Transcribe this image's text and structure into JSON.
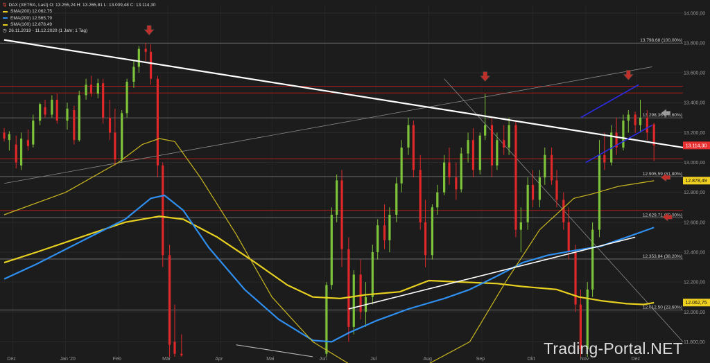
{
  "header": {
    "title": "DAX (XETRA, Last)",
    "ohlc": "O: 13.255,24 H: 13.265,81 L: 13.009,48 C: 13.114,30",
    "indicators": [
      {
        "label": "SMA(200)",
        "value": "12.062,75",
        "color": "#e8d020"
      },
      {
        "label": "EMA(200)",
        "value": "12.565,79",
        "color": "#2f8ff0"
      },
      {
        "label": "SMA(100)",
        "value": "12.878,49",
        "color": "#e8d020"
      }
    ],
    "range": "26.11.2019 - 11.12.2020",
    "interval": "(1 Jahr; 1 Tag)"
  },
  "watermark": "Trading-Portal.NET",
  "chart_data": {
    "type": "candlestick",
    "instrument": "DAX (XETRA, Last)",
    "ylim": [
      11700,
      14050
    ],
    "y_ticks": [
      {
        "v": 14000,
        "label": "14.000,00"
      },
      {
        "v": 13800,
        "label": "13.800,00"
      },
      {
        "v": 13600,
        "label": "13.600,00"
      },
      {
        "v": 13400,
        "label": "13.400,00"
      },
      {
        "v": 13200,
        "label": "13.200,00"
      },
      {
        "v": 13000,
        "label": "13.000,00"
      },
      {
        "v": 12800,
        "label": "12.800,00"
      },
      {
        "v": 12600,
        "label": "12.600,00"
      },
      {
        "v": 12400,
        "label": "12.400,00"
      },
      {
        "v": 12200,
        "label": "12.200,00"
      },
      {
        "v": 12000,
        "label": "12.000,00"
      },
      {
        "v": 11800,
        "label": "11.800,00"
      }
    ],
    "x_ticks": [
      {
        "date": "2019-12-01",
        "label": "Dez"
      },
      {
        "date": "2020-01-01",
        "label": "Jan '20"
      },
      {
        "date": "2020-02-01",
        "label": "Feb"
      },
      {
        "date": "2020-03-01",
        "label": "Mär"
      },
      {
        "date": "2020-04-01",
        "label": "Apr"
      },
      {
        "date": "2020-05-01",
        "label": "Mai"
      },
      {
        "date": "2020-06-01",
        "label": "Jun"
      },
      {
        "date": "2020-07-01",
        "label": "Jul"
      },
      {
        "date": "2020-08-01",
        "label": "Aug"
      },
      {
        "date": "2020-09-01",
        "label": "Sep"
      },
      {
        "date": "2020-10-01",
        "label": "Okt"
      },
      {
        "date": "2020-11-01",
        "label": "Nov"
      },
      {
        "date": "2020-12-01",
        "label": "Dez"
      }
    ],
    "x_range": [
      "2019-11-26",
      "2020-12-28"
    ],
    "fib_levels": [
      {
        "v": 13798.68,
        "label": "13.798,68 (100,00%)"
      },
      {
        "v": 13298.36,
        "label": "13.298,36 (78,60%)"
      },
      {
        "v": 12905.59,
        "label": "12.905,59 (61,80%)"
      },
      {
        "v": 12629.71,
        "label": "12.629,71 (50,00%)"
      },
      {
        "v": 12353.84,
        "label": "12.353,84 (38,20%)"
      },
      {
        "v": 12012.5,
        "label": "12.012,50 (23,60%)"
      }
    ],
    "red_lines": [
      13510,
      13465,
      13025,
      12680
    ],
    "price_tags": [
      {
        "v": 13114.3,
        "label": "13.114,30",
        "bg": "#e83030",
        "fg": "#ffffff"
      },
      {
        "v": 12878.49,
        "label": "12.878,49",
        "bg": "#f0d020",
        "fg": "#111111"
      },
      {
        "v": 12062.75,
        "label": "12.062,75",
        "bg": "#f0d020",
        "fg": "#111111"
      }
    ],
    "trendlines": [
      {
        "name": "resistance",
        "color": "#ffffff",
        "width": 2.2,
        "from": [
          "2019-11-26",
          13820
        ],
        "to": [
          "2020-12-28",
          13100
        ]
      },
      {
        "name": "support",
        "color": "#ffffff",
        "width": 1.6,
        "from": [
          "2020-06-15",
          12020
        ],
        "to": [
          "2020-11-30",
          12500
        ]
      },
      {
        "name": "support-early",
        "color": "#bdbdbd",
        "width": 1.1,
        "from": [
          "2020-04-10",
          11780
        ],
        "to": [
          "2020-05-25",
          11700
        ]
      },
      {
        "name": "upper-channel",
        "color": "#2c2ce8",
        "width": 1.6,
        "from": [
          "2020-10-29",
          13300
        ],
        "to": [
          "2020-12-02",
          13520
        ]
      },
      {
        "name": "lower-channel",
        "color": "#2c2ce8",
        "width": 1.6,
        "from": [
          "2020-11-01",
          13000
        ],
        "to": [
          "2020-12-10",
          13250
        ]
      },
      {
        "name": "thin-rising",
        "color": "#8a8a8a",
        "width": 0.8,
        "from": [
          "2019-11-26",
          12860
        ],
        "to": [
          "2020-12-10",
          13640
        ]
      },
      {
        "name": "thin-falling",
        "color": "#8a8a8a",
        "width": 0.8,
        "from": [
          "2020-08-10",
          13560
        ],
        "to": [
          "2020-12-28",
          11800
        ]
      }
    ],
    "markers": [
      {
        "type": "arrow-down",
        "date": "2020-02-19",
        "v": 13880,
        "color": "#c0302a"
      },
      {
        "type": "arrow-down",
        "date": "2020-09-03",
        "v": 13570,
        "color": "#c0302a"
      },
      {
        "type": "arrow-down",
        "date": "2020-11-26",
        "v": 13580,
        "color": "#c0302a"
      },
      {
        "type": "arrow-left",
        "date": "2020-12-17",
        "v": 13330,
        "color": "#9a9a9a"
      },
      {
        "type": "arrow-left",
        "date": "2020-12-17",
        "v": 12900,
        "color": "#c0302a"
      },
      {
        "type": "arrow-left",
        "date": "2020-12-18",
        "v": 12635,
        "color": "#c0302a"
      }
    ],
    "series": [
      {
        "name": "SMA(200)",
        "color": "#e8d020",
        "width": 2.2,
        "points": [
          [
            "2019-11-26",
            12330
          ],
          [
            "2019-12-15",
            12400
          ],
          [
            "2020-01-15",
            12520
          ],
          [
            "2020-02-05",
            12600
          ],
          [
            "2020-02-25",
            12640
          ],
          [
            "2020-03-10",
            12620
          ],
          [
            "2020-03-30",
            12500
          ],
          [
            "2020-04-20",
            12340
          ],
          [
            "2020-05-10",
            12180
          ],
          [
            "2020-05-25",
            12100
          ],
          [
            "2020-06-10",
            12090
          ],
          [
            "2020-06-25",
            12115
          ],
          [
            "2020-07-15",
            12135
          ],
          [
            "2020-08-01",
            12210
          ],
          [
            "2020-08-20",
            12200
          ],
          [
            "2020-09-10",
            12190
          ],
          [
            "2020-09-25",
            12170
          ],
          [
            "2020-10-15",
            12150
          ],
          [
            "2020-10-28",
            12100
          ],
          [
            "2020-11-10",
            12075
          ],
          [
            "2020-11-25",
            12055
          ],
          [
            "2020-12-05",
            12050
          ],
          [
            "2020-12-11",
            12062
          ]
        ]
      },
      {
        "name": "EMA(200)",
        "color": "#2f8ff0",
        "width": 2.2,
        "points": [
          [
            "2019-11-26",
            12220
          ],
          [
            "2019-12-15",
            12320
          ],
          [
            "2020-01-15",
            12500
          ],
          [
            "2020-02-05",
            12620
          ],
          [
            "2020-02-20",
            12760
          ],
          [
            "2020-02-28",
            12780
          ],
          [
            "2020-03-10",
            12680
          ],
          [
            "2020-03-25",
            12430
          ],
          [
            "2020-04-15",
            12150
          ],
          [
            "2020-05-05",
            11950
          ],
          [
            "2020-05-25",
            11810
          ],
          [
            "2020-06-05",
            11800
          ],
          [
            "2020-06-15",
            11860
          ],
          [
            "2020-07-01",
            11940
          ],
          [
            "2020-07-20",
            12020
          ],
          [
            "2020-08-10",
            12090
          ],
          [
            "2020-08-25",
            12150
          ],
          [
            "2020-09-10",
            12240
          ],
          [
            "2020-09-25",
            12330
          ],
          [
            "2020-10-10",
            12380
          ],
          [
            "2020-10-25",
            12410
          ],
          [
            "2020-11-10",
            12440
          ],
          [
            "2020-11-25",
            12500
          ],
          [
            "2020-12-11",
            12565
          ]
        ]
      },
      {
        "name": "SMA(100)",
        "color": "#cbb820",
        "width": 1.2,
        "points": [
          [
            "2019-11-26",
            12650
          ],
          [
            "2020-01-01",
            12800
          ],
          [
            "2020-02-01",
            13000
          ],
          [
            "2020-02-15",
            13120
          ],
          [
            "2020-02-25",
            13160
          ],
          [
            "2020-03-05",
            13140
          ],
          [
            "2020-03-20",
            12900
          ],
          [
            "2020-04-10",
            12520
          ],
          [
            "2020-05-01",
            12100
          ],
          [
            "2020-05-25",
            11800
          ],
          [
            "2020-06-15",
            11550
          ],
          [
            "2020-07-05",
            11400
          ],
          [
            "2020-08-01",
            11500
          ],
          [
            "2020-08-25",
            11800
          ],
          [
            "2020-09-15",
            12200
          ],
          [
            "2020-10-05",
            12550
          ],
          [
            "2020-10-25",
            12760
          ],
          [
            "2020-11-05",
            12790
          ],
          [
            "2020-11-20",
            12840
          ],
          [
            "2020-12-11",
            12878
          ]
        ]
      }
    ],
    "candles": [
      [
        "2019-11-26",
        13200,
        13230,
        13140,
        13160
      ],
      [
        "2019-11-29",
        13150,
        13210,
        13080,
        13190
      ],
      [
        "2019-12-03",
        13120,
        13180,
        12960,
        13000
      ],
      [
        "2019-12-06",
        12980,
        13200,
        12950,
        13160
      ],
      [
        "2019-12-10",
        13150,
        13220,
        13080,
        13110
      ],
      [
        "2019-12-13",
        13120,
        13320,
        13100,
        13280
      ],
      [
        "2019-12-17",
        13280,
        13400,
        13250,
        13390
      ],
      [
        "2019-12-20",
        13370,
        13420,
        13300,
        13320
      ],
      [
        "2019-12-24",
        13320,
        13450,
        13300,
        13420
      ],
      [
        "2019-12-27",
        13420,
        13460,
        13260,
        13280
      ],
      [
        "2020-01-02",
        13280,
        13400,
        13220,
        13360
      ],
      [
        "2020-01-06",
        13350,
        13380,
        13120,
        13150
      ],
      [
        "2020-01-09",
        13150,
        13480,
        13140,
        13450
      ],
      [
        "2020-01-13",
        13450,
        13560,
        13420,
        13520
      ],
      [
        "2020-01-16",
        13520,
        13580,
        13440,
        13460
      ],
      [
        "2020-01-20",
        13460,
        13560,
        13430,
        13530
      ],
      [
        "2020-01-23",
        13530,
        13560,
        13260,
        13300
      ],
      [
        "2020-01-27",
        13300,
        13420,
        13150,
        13200
      ],
      [
        "2020-01-30",
        13200,
        13360,
        12980,
        13020
      ],
      [
        "2020-02-03",
        13020,
        13350,
        13000,
        13330
      ],
      [
        "2020-02-06",
        13330,
        13560,
        13300,
        13540
      ],
      [
        "2020-02-10",
        13540,
        13680,
        13500,
        13640
      ],
      [
        "2020-02-13",
        13640,
        13780,
        13600,
        13760
      ],
      [
        "2020-02-17",
        13760,
        13800,
        13680,
        13740
      ],
      [
        "2020-02-20",
        13740,
        13790,
        13520,
        13560
      ],
      [
        "2020-02-24",
        13560,
        13580,
        12900,
        12980
      ],
      [
        "2020-02-27",
        12980,
        13000,
        12300,
        12380
      ],
      [
        "2020-03-02",
        12380,
        12450,
        11700,
        11780
      ],
      [
        "2020-03-05",
        11800,
        12050,
        11700,
        11720
      ],
      [
        "2020-03-09",
        11720,
        11850,
        11700,
        11710
      ],
      [
        "2020-06-02",
        11720,
        12200,
        11700,
        12180
      ],
      [
        "2020-06-05",
        12180,
        12700,
        12150,
        12650
      ],
      [
        "2020-06-08",
        12650,
        12920,
        12600,
        12880
      ],
      [
        "2020-06-11",
        12880,
        12950,
        12300,
        12420
      ],
      [
        "2020-06-15",
        12420,
        12500,
        11800,
        11900
      ],
      [
        "2020-06-18",
        11900,
        12280,
        11850,
        12250
      ],
      [
        "2020-06-22",
        12250,
        12350,
        11950,
        12000
      ],
      [
        "2020-06-25",
        12000,
        12200,
        11900,
        12100
      ],
      [
        "2020-06-29",
        12100,
        12450,
        12050,
        12400
      ],
      [
        "2020-07-02",
        12400,
        12620,
        12350,
        12580
      ],
      [
        "2020-07-06",
        12580,
        12720,
        12420,
        12480
      ],
      [
        "2020-07-09",
        12480,
        12700,
        12400,
        12650
      ],
      [
        "2020-07-13",
        12650,
        12900,
        12600,
        12860
      ],
      [
        "2020-07-16",
        12860,
        13150,
        12800,
        13100
      ],
      [
        "2020-07-20",
        13100,
        13300,
        13050,
        13250
      ],
      [
        "2020-07-23",
        13250,
        13280,
        12900,
        12950
      ],
      [
        "2020-07-27",
        12950,
        13050,
        12550,
        12600
      ],
      [
        "2020-07-30",
        12600,
        12750,
        12300,
        12380
      ],
      [
        "2020-08-03",
        12380,
        12720,
        12350,
        12700
      ],
      [
        "2020-08-06",
        12700,
        12850,
        12650,
        12800
      ],
      [
        "2020-08-10",
        12800,
        13050,
        12780,
        13000
      ],
      [
        "2020-08-13",
        13000,
        13100,
        12850,
        12900
      ],
      [
        "2020-08-17",
        12900,
        13000,
        12750,
        12820
      ],
      [
        "2020-08-20",
        12820,
        13100,
        12800,
        13060
      ],
      [
        "2020-08-24",
        13060,
        13200,
        13000,
        13150
      ],
      [
        "2020-08-27",
        13150,
        13230,
        12900,
        12950
      ],
      [
        "2020-08-31",
        12950,
        13200,
        12920,
        13180
      ],
      [
        "2020-09-03",
        13180,
        13460,
        13150,
        13250
      ],
      [
        "2020-09-07",
        13250,
        13300,
        12900,
        12980
      ],
      [
        "2020-09-10",
        12980,
        13200,
        12950,
        13150
      ],
      [
        "2020-09-14",
        13150,
        13250,
        13050,
        13100
      ],
      [
        "2020-09-17",
        13100,
        13300,
        13050,
        13250
      ],
      [
        "2020-09-21",
        13250,
        13280,
        12500,
        12550
      ],
      [
        "2020-09-24",
        12550,
        12700,
        12400,
        12600
      ],
      [
        "2020-09-28",
        12600,
        12900,
        12550,
        12850
      ],
      [
        "2020-10-01",
        12850,
        12950,
        12700,
        12750
      ],
      [
        "2020-10-05",
        12750,
        12950,
        12700,
        12900
      ],
      [
        "2020-10-08",
        12900,
        13100,
        12850,
        13050
      ],
      [
        "2020-10-12",
        13050,
        13100,
        12850,
        12880
      ],
      [
        "2020-10-15",
        12880,
        12950,
        12700,
        12750
      ],
      [
        "2020-10-19",
        12750,
        12800,
        12550,
        12600
      ],
      [
        "2020-10-22",
        12600,
        12700,
        12350,
        12400
      ],
      [
        "2020-10-26",
        12400,
        12450,
        12000,
        12050
      ],
      [
        "2020-10-29",
        12050,
        12150,
        11700,
        11750
      ],
      [
        "2020-11-02",
        11750,
        12200,
        11700,
        12150
      ],
      [
        "2020-11-05",
        12150,
        12600,
        12100,
        12550
      ],
      [
        "2020-11-09",
        12550,
        13150,
        12500,
        13050
      ],
      [
        "2020-11-12",
        13050,
        13200,
        12950,
        13000
      ],
      [
        "2020-11-16",
        13000,
        13250,
        12980,
        13200
      ],
      [
        "2020-11-19",
        13200,
        13300,
        13050,
        13100
      ],
      [
        "2020-11-23",
        13100,
        13320,
        13080,
        13280
      ],
      [
        "2020-11-26",
        13280,
        13350,
        13200,
        13320
      ],
      [
        "2020-11-30",
        13320,
        13340,
        13200,
        13250
      ],
      [
        "2020-12-03",
        13250,
        13420,
        13200,
        13300
      ],
      [
        "2020-12-07",
        13300,
        13350,
        13150,
        13200
      ],
      [
        "2020-12-11",
        13255,
        13265,
        13009,
        13114
      ]
    ]
  }
}
